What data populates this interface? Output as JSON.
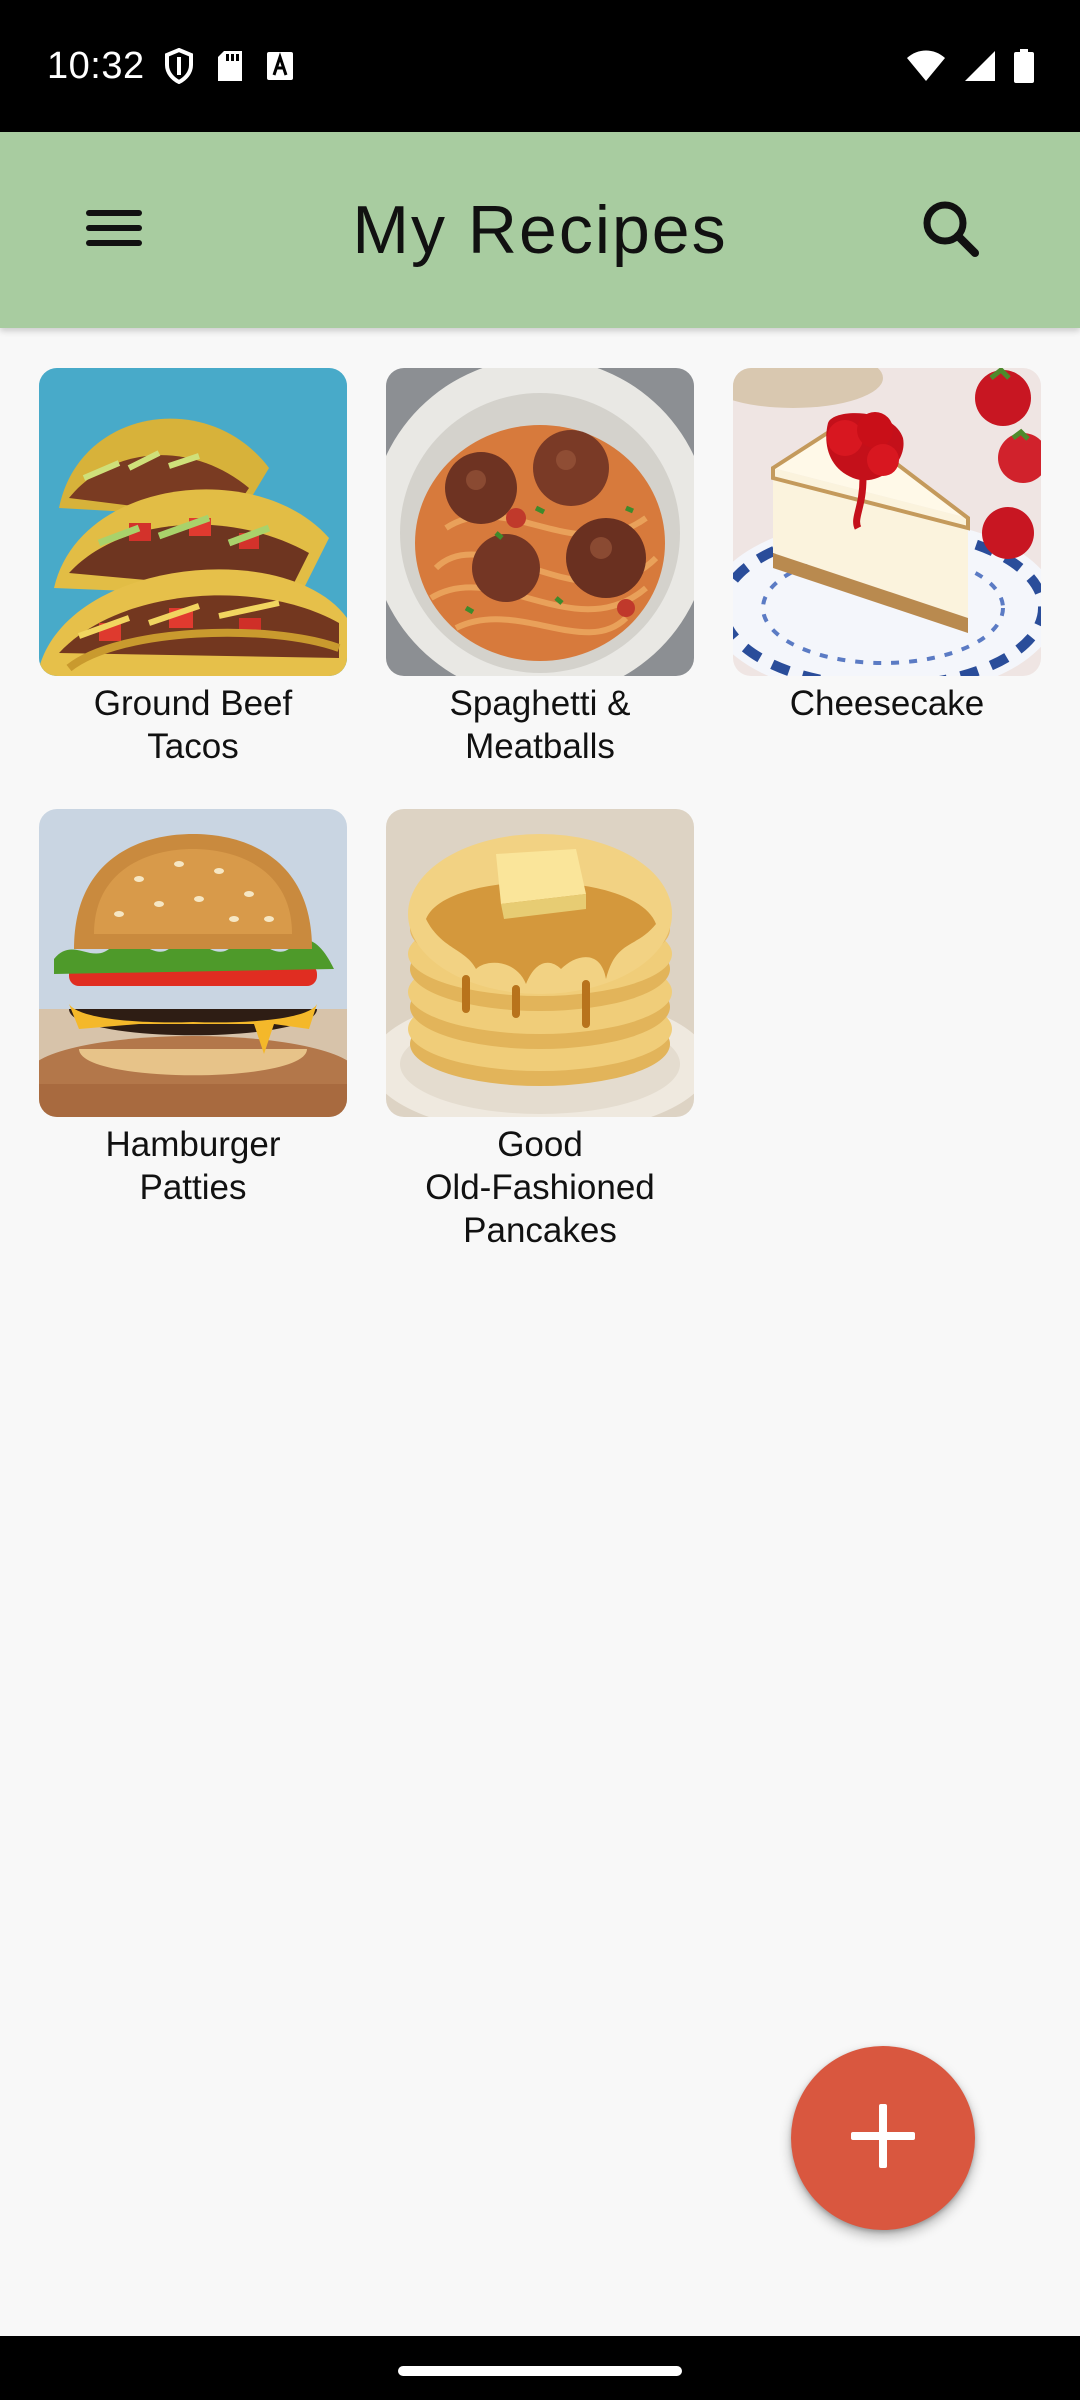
{
  "status_bar": {
    "time": "10:32",
    "left_icons": [
      "shield-icon",
      "sd-card-icon",
      "font-a-icon"
    ],
    "right_icons": [
      "wifi-icon",
      "cellular-signal-icon",
      "battery-icon"
    ]
  },
  "app_bar": {
    "title": "My Recipes",
    "menu_icon": "menu-icon",
    "search_icon": "search-icon",
    "background_color": "#a8cca0"
  },
  "recipes": [
    {
      "name": "Ground Beef\nTacos"
    },
    {
      "name": "Spaghetti &\nMeatballs"
    },
    {
      "name": "Cheesecake"
    },
    {
      "name": "Hamburger\nPatties"
    },
    {
      "name": "Good\nOld-Fashioned\nPancakes"
    }
  ],
  "fab": {
    "icon": "plus-icon",
    "color": "#d9573f"
  }
}
